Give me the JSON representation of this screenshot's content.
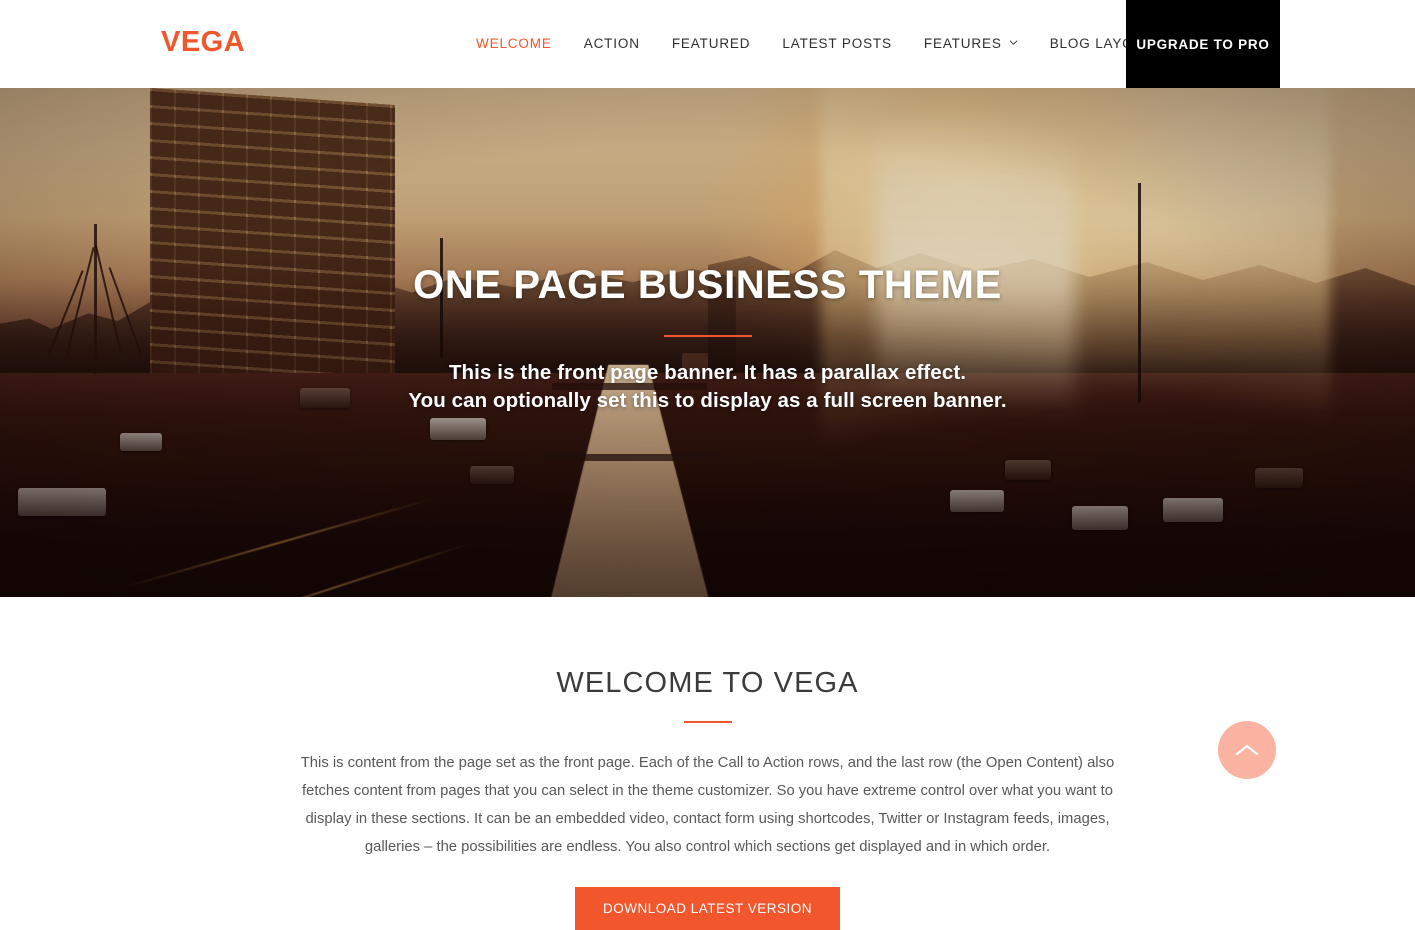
{
  "header": {
    "brand": "VEGA",
    "nav": [
      {
        "label": "WELCOME",
        "active": true,
        "has_dropdown": false
      },
      {
        "label": "ACTION",
        "active": false,
        "has_dropdown": false
      },
      {
        "label": "FEATURED",
        "active": false,
        "has_dropdown": false
      },
      {
        "label": "LATEST POSTS",
        "active": false,
        "has_dropdown": false
      },
      {
        "label": "FEATURES",
        "active": false,
        "has_dropdown": true
      },
      {
        "label": "BLOG LAYOUTS",
        "active": false,
        "has_dropdown": true
      }
    ],
    "upgrade_label": "UPGRADE TO PRO",
    "brand_color": "#f1562c",
    "upgrade_bg": "#000000"
  },
  "hero": {
    "title": "ONE PAGE BUSINESS THEME",
    "subtitle_line1": "This is the front page banner. It has a parallax effect.",
    "subtitle_line2": "You can optionally set this to display as a full screen banner.",
    "divider_color": "#f1562c"
  },
  "welcome": {
    "title": "WELCOME TO VEGA",
    "divider_color": "#f1562c",
    "body": "This is content from the page set as the front page. Each of the Call to Action rows, and the last row (the Open Content) also fetches content from pages that you can select in the theme customizer. So you have extreme control over what you want to display in these sections. It can be an embedded video, contact form using shortcodes, Twitter or Instagram feeds, images, galleries – the possibilities are endless. You also control which sections get displayed and in which order.",
    "cta_label": "DOWNLOAD LATEST VERSION",
    "cta_color": "#f1562c"
  },
  "back_to_top": {
    "icon": "chevron-up-icon",
    "color": "#f1562c"
  }
}
